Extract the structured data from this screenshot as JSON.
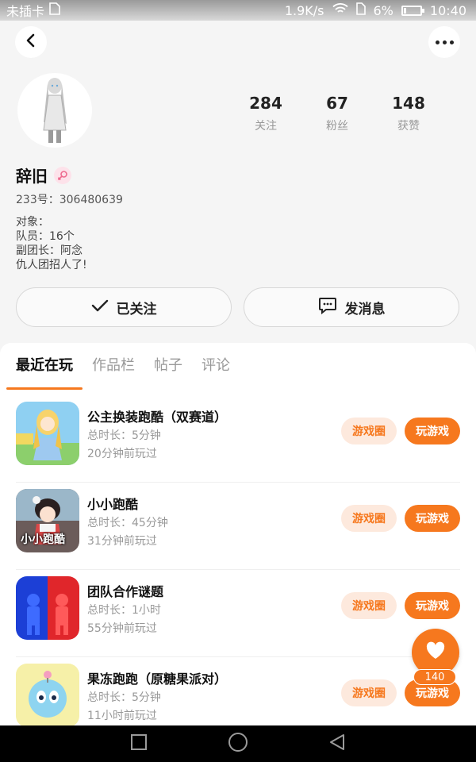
{
  "status_bar": {
    "carrier": "未插卡",
    "speed": "1.9K/s",
    "battery": "6%",
    "time": "10:40"
  },
  "profile": {
    "username": "辞旧",
    "uid": "233号：306480639",
    "bio": [
      "对象：",
      "队员：16个",
      "副团长：阿念",
      "仇人团招人了!"
    ],
    "stats": [
      {
        "value": "284",
        "label": "关注"
      },
      {
        "value": "67",
        "label": "粉丝"
      },
      {
        "value": "148",
        "label": "获赞"
      }
    ]
  },
  "actions": {
    "follow_label": "已关注",
    "message_label": "发消息"
  },
  "tabs": [
    {
      "label": "最近在玩",
      "active": true
    },
    {
      "label": "作品栏",
      "active": false
    },
    {
      "label": "帖子",
      "active": false
    },
    {
      "label": "评论",
      "active": false
    }
  ],
  "games": [
    {
      "name": "公主换装跑酷（双赛道）",
      "duration": "总时长：5分钟",
      "last_played": "20分钟前玩过",
      "circle_label": "游戏圈",
      "play_label": "玩游戏"
    },
    {
      "name": "小小跑酷",
      "duration": "总时长：45分钟",
      "last_played": "31分钟前玩过",
      "circle_label": "游戏圈",
      "play_label": "玩游戏",
      "icon_text": "小小跑酷"
    },
    {
      "name": "团队合作谜题",
      "duration": "总时长：1小时",
      "last_played": "55分钟前玩过",
      "circle_label": "游戏圈",
      "play_label": "玩游戏"
    },
    {
      "name": "果冻跑跑（原糖果派对）",
      "duration": "总时长：5分钟",
      "last_played": "11小时前玩过",
      "circle_label": "游戏圈",
      "play_label": "玩游戏"
    }
  ],
  "like": {
    "count": "140"
  },
  "colors": {
    "accent": "#f6781e",
    "accent_light": "#fde9dd"
  }
}
